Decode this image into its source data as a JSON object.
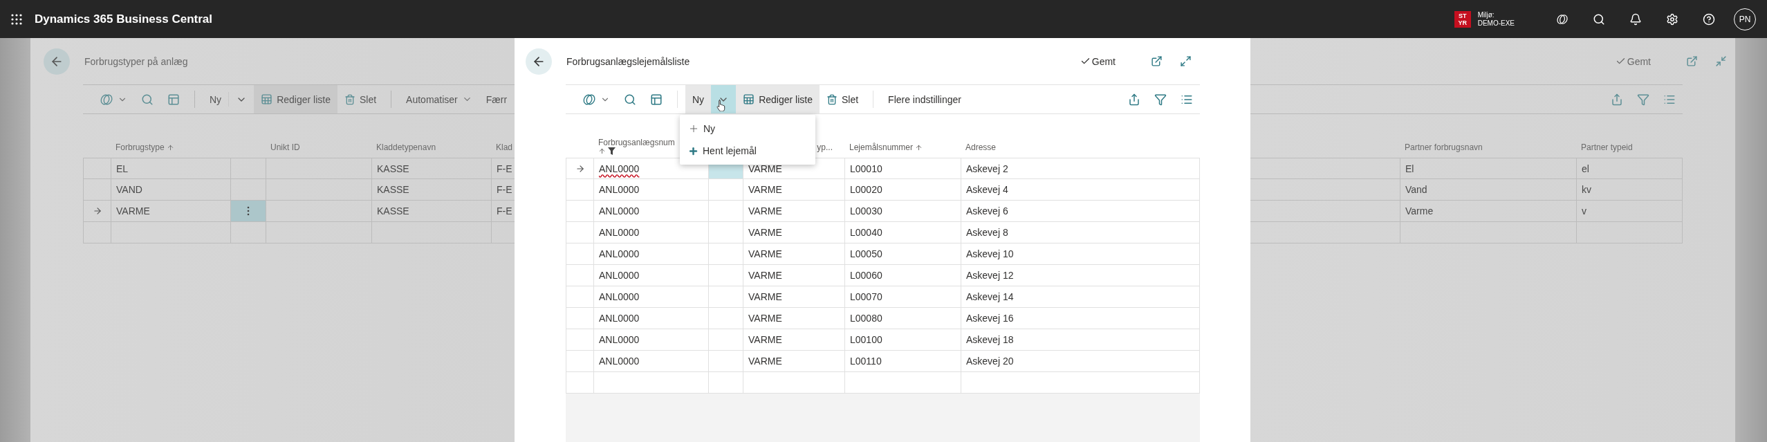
{
  "top_bar": {
    "app_title": "Dynamics 365 Business Central",
    "environment_badge": [
      "ST",
      "YR"
    ],
    "environment_label": "Miljø:",
    "environment_name": "DEMO-EXE",
    "avatar_initials": "PN"
  },
  "background_page": {
    "title": "Forbrugstyper på anlæg",
    "save_status": "Gemt",
    "toolbar": [
      {
        "kind": "copilot"
      },
      {
        "kind": "search"
      },
      {
        "kind": "layout"
      },
      {
        "kind": "separator"
      },
      {
        "kind": "split",
        "label": "Ny",
        "open": false
      },
      {
        "kind": "edit",
        "label": "Rediger liste",
        "active": true
      },
      {
        "kind": "delete",
        "label": "Slet"
      },
      {
        "kind": "separator"
      },
      {
        "kind": "menu",
        "label": "Automatiser"
      },
      {
        "kind": "text",
        "label": "Færr"
      }
    ],
    "left_columns": [
      {
        "label": "Forbrugstype",
        "sorted": true
      },
      {
        "label": "Unikt ID",
        "sorted": false
      },
      {
        "label": "Kladdetypenavn",
        "sorted": false
      },
      {
        "label": "Klad",
        "sorted": false
      }
    ],
    "left_rows": [
      {
        "selected": false,
        "forbrugstype": "EL",
        "kladdetypenavn": "KASSE",
        "column_5": "F-E"
      },
      {
        "selected": false,
        "forbrugstype": "VAND",
        "kladdetypenavn": "KASSE",
        "column_5": "F-E"
      },
      {
        "selected": true,
        "forbrugstype": "VARME",
        "kladdetypenavn": "KASSE",
        "column_5": "F-E"
      }
    ],
    "right_columns": [
      {
        "label": "Partner forbrugsnavn"
      },
      {
        "label": "Partner typeid"
      }
    ],
    "right_rows": [
      {
        "partner_forbrugsnavn": "El",
        "partner_typeid": "el"
      },
      {
        "partner_forbrugsnavn": "Vand",
        "partner_typeid": "kv"
      },
      {
        "partner_forbrugsnavn": "Varme",
        "partner_typeid": "v"
      }
    ]
  },
  "dialog": {
    "title": "Forbrugsanlægslejemålsliste",
    "save_status": "Gemt",
    "toolbar": [
      {
        "kind": "copilot"
      },
      {
        "kind": "search"
      },
      {
        "kind": "layout"
      },
      {
        "kind": "separator"
      },
      {
        "kind": "split",
        "label": "Ny",
        "open": true
      },
      {
        "kind": "edit",
        "label": "Rediger liste",
        "active": true
      },
      {
        "kind": "delete",
        "label": "Slet"
      },
      {
        "kind": "separator"
      },
      {
        "kind": "text",
        "label": "Flere indstillinger"
      }
    ],
    "new_menu": [
      {
        "kind": "add",
        "label": "Ny"
      },
      {
        "kind": "fetch",
        "label": "Hent lejemål"
      }
    ],
    "columns": [
      {
        "label": "Forbrugsanlægsnum",
        "sorted": true,
        "filtered": true
      },
      {
        "label": "yp...",
        "sorted": false,
        "filtered": false
      },
      {
        "label": "Lejemålsnummer",
        "sorted": true,
        "filtered": false
      },
      {
        "label": "Adresse",
        "sorted": false,
        "filtered": false
      }
    ],
    "rows": [
      {
        "selected": true,
        "flagged": true,
        "forbrugsanlaeg": "ANL0000",
        "column_3": "VARME",
        "lejemaalsnummer": "L00010",
        "adresse": "Askevej 2"
      },
      {
        "selected": false,
        "flagged": false,
        "forbrugsanlaeg": "ANL0000",
        "column_3": "VARME",
        "lejemaalsnummer": "L00020",
        "adresse": "Askevej 4"
      },
      {
        "selected": false,
        "flagged": false,
        "forbrugsanlaeg": "ANL0000",
        "column_3": "VARME",
        "lejemaalsnummer": "L00030",
        "adresse": "Askevej 6"
      },
      {
        "selected": false,
        "flagged": false,
        "forbrugsanlaeg": "ANL0000",
        "column_3": "VARME",
        "lejemaalsnummer": "L00040",
        "adresse": "Askevej 8"
      },
      {
        "selected": false,
        "flagged": false,
        "forbrugsanlaeg": "ANL0000",
        "column_3": "VARME",
        "lejemaalsnummer": "L00050",
        "adresse": "Askevej 10"
      },
      {
        "selected": false,
        "flagged": false,
        "forbrugsanlaeg": "ANL0000",
        "column_3": "VARME",
        "lejemaalsnummer": "L00060",
        "adresse": "Askevej 12"
      },
      {
        "selected": false,
        "flagged": false,
        "forbrugsanlaeg": "ANL0000",
        "column_3": "VARME",
        "lejemaalsnummer": "L00070",
        "adresse": "Askevej 14"
      },
      {
        "selected": false,
        "flagged": false,
        "forbrugsanlaeg": "ANL0000",
        "column_3": "VARME",
        "lejemaalsnummer": "L00080",
        "adresse": "Askevej 16"
      },
      {
        "selected": false,
        "flagged": false,
        "forbrugsanlaeg": "ANL0000",
        "column_3": "VARME",
        "lejemaalsnummer": "L00100",
        "adresse": "Askevej 18"
      },
      {
        "selected": false,
        "flagged": false,
        "forbrugsanlaeg": "ANL0000",
        "column_3": "VARME",
        "lejemaalsnummer": "L00110",
        "adresse": "Askevej 20"
      }
    ]
  }
}
